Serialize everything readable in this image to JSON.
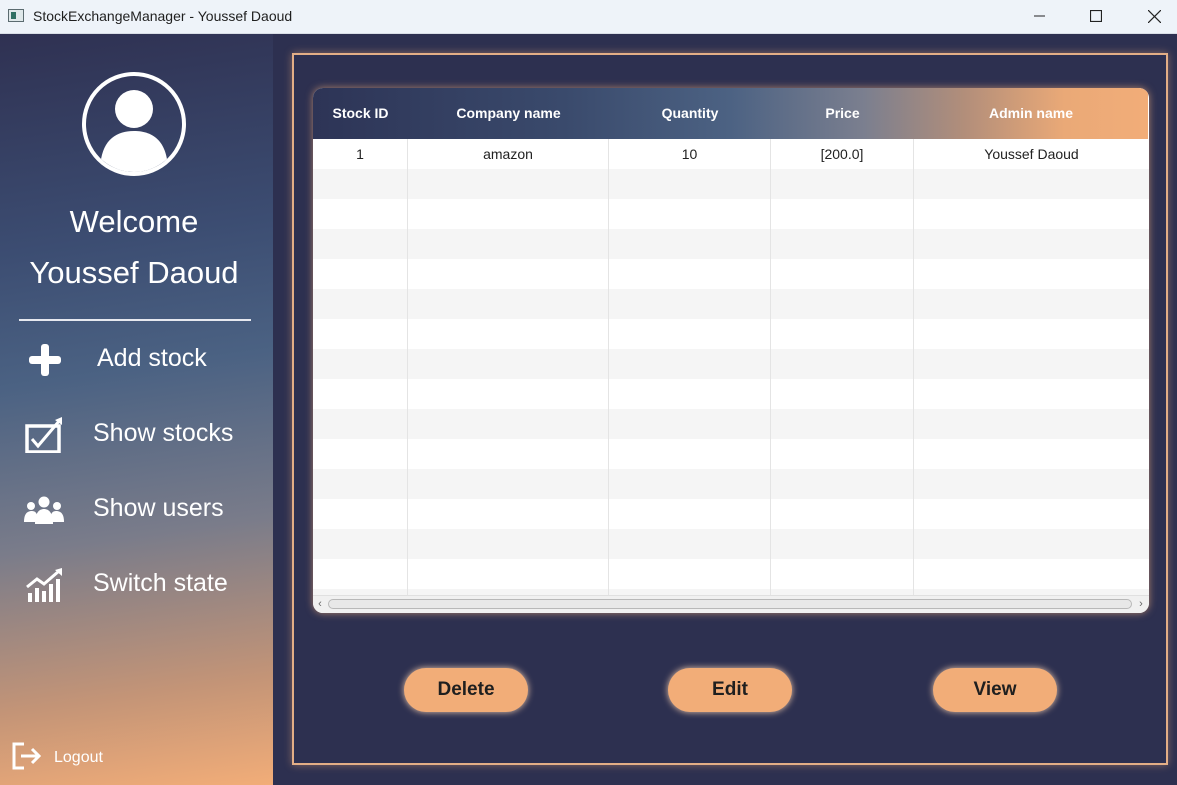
{
  "window": {
    "title": "StockExchangeManager - Youssef Daoud",
    "controls": [
      "minimize-icon",
      "maximize-icon",
      "close-icon"
    ]
  },
  "sidebar": {
    "avatar_icon": "user-avatar-icon",
    "welcome_line1": "Welcome",
    "welcome_line2": "Youssef Daoud",
    "items": [
      {
        "label": "Add stock",
        "icon": "plus-icon"
      },
      {
        "label": "Show stocks",
        "icon": "chart-check-icon"
      },
      {
        "label": "Show users",
        "icon": "users-icon"
      },
      {
        "label": "Switch state",
        "icon": "trend-up-icon"
      }
    ],
    "logout": {
      "label": "Logout",
      "icon": "logout-icon"
    }
  },
  "table": {
    "columns": [
      "Stock ID",
      "Company name",
      "Quantity",
      "Price",
      "Admin name"
    ],
    "rows": [
      [
        "1",
        "amazon",
        "10",
        "[200.0]",
        "Youssef Daoud"
      ]
    ]
  },
  "actions": {
    "delete": "Delete",
    "edit": "Edit",
    "view": "View"
  },
  "colors": {
    "accent": "#f2ad78",
    "background": "#2d3050",
    "sidebar_top": "#2f3152",
    "sidebar_bottom": "#f2ad78"
  }
}
